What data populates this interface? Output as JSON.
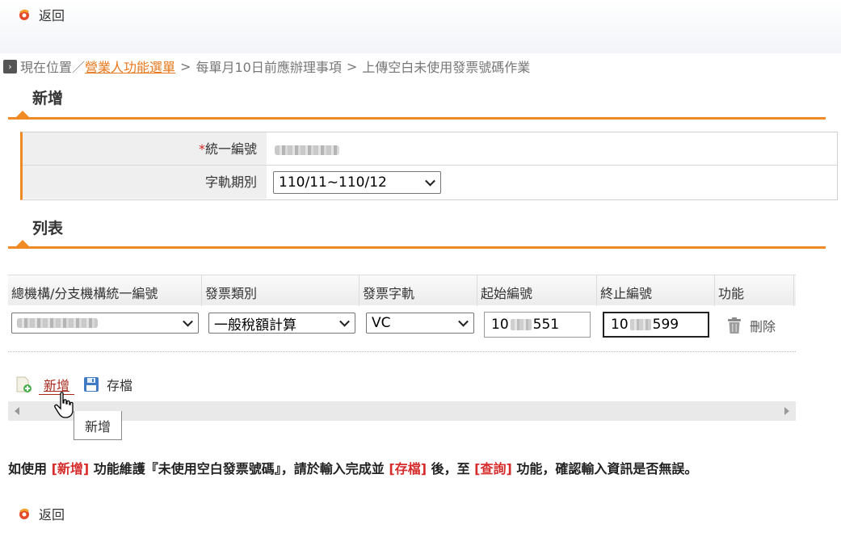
{
  "nav": {
    "back_label": "返回",
    "breadcrumb": {
      "prefix": "現在位置",
      "link": "營業人功能選單",
      "items": [
        "每單月10日前應辦理事項",
        "上傳空白未使用發票號碼作業"
      ],
      "separator": ">"
    }
  },
  "add_section": {
    "title": "新增",
    "fields": [
      {
        "required_mark": "*",
        "label": "統一編號",
        "value": "(masked)"
      },
      {
        "label": "字軌期別",
        "value": "110/11~110/12"
      }
    ]
  },
  "list_section": {
    "title": "列表",
    "columns": [
      "總機構/分支機構統一編號",
      "發票類別",
      "發票字軌",
      "起始編號",
      "終止編號",
      "功能"
    ],
    "row": {
      "branch_id": "(masked)",
      "invoice_type": "一般稅額計算",
      "track": "VC",
      "start_prefix": "10",
      "start_suffix": "551",
      "end_prefix": "10",
      "end_suffix": "599",
      "delete_label": "刪除"
    }
  },
  "toolbar": {
    "add_label": "新增",
    "save_label": "存檔",
    "tooltip": "新增"
  },
  "notice": {
    "p1": "如使用 ",
    "k1": "[新增]",
    "p2": " 功能維護『未使用空白發票號碼』，請於輸入完成並 ",
    "k2": "[存檔]",
    "p3": " 後，至 ",
    "k3": "[查詢]",
    "p4": " 功能，確認輸入資訊是否無誤。"
  },
  "colors": {
    "accent": "#f08a24",
    "link": "#e8781c",
    "required": "#d62b2b",
    "add_link": "#a8291c"
  }
}
